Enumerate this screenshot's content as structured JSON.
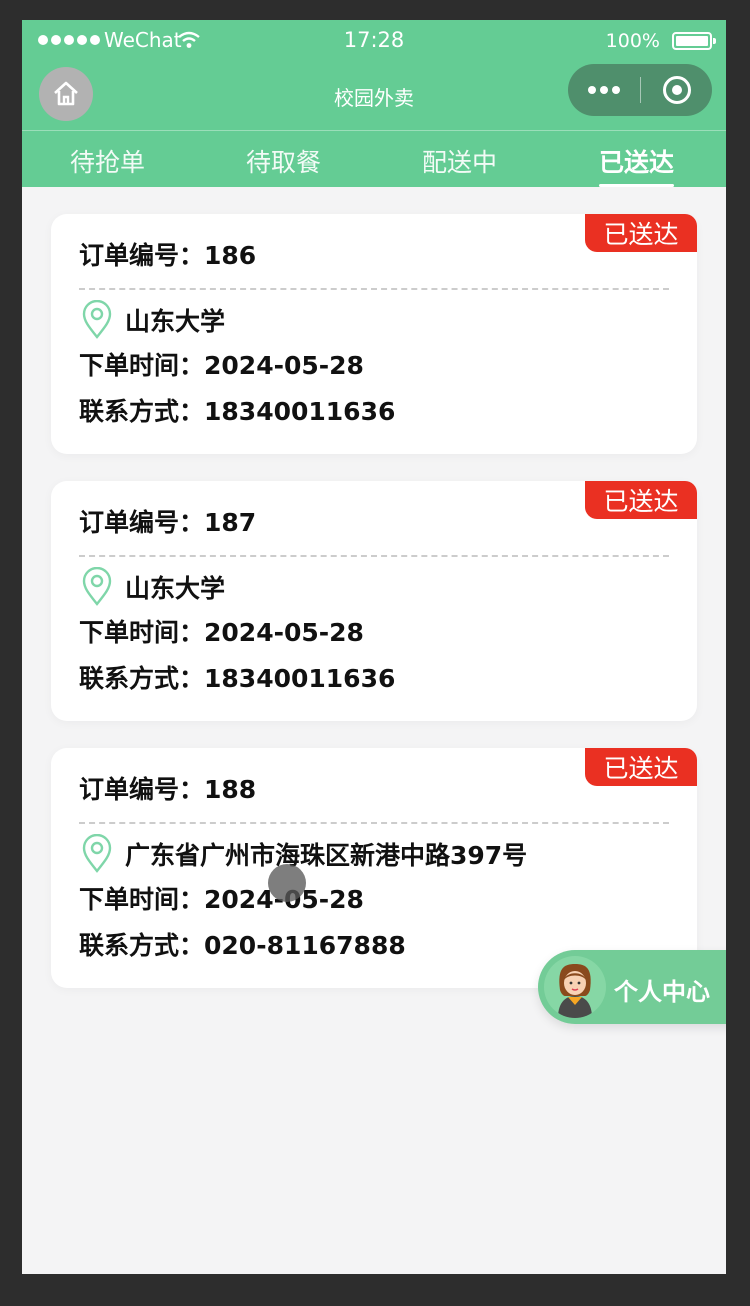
{
  "status_bar": {
    "carrier": "WeChat",
    "time": "17:28",
    "battery": "100%"
  },
  "nav": {
    "title": "校园外卖"
  },
  "tabs": [
    {
      "label": "待抢单",
      "active": false
    },
    {
      "label": "待取餐",
      "active": false
    },
    {
      "label": "配送中",
      "active": false
    },
    {
      "label": "已送达",
      "active": true
    }
  ],
  "labels": {
    "order_no": "订单编号：",
    "order_time": "下单时间：",
    "contact": "联系方式："
  },
  "orders": [
    {
      "status": "已送达",
      "order_no": "186",
      "address": "山东大学",
      "order_time": "2024-05-28",
      "contact": "18340011636"
    },
    {
      "status": "已送达",
      "order_no": "187",
      "address": "山东大学",
      "order_time": "2024-05-28",
      "contact": "18340011636"
    },
    {
      "status": "已送达",
      "order_no": "188",
      "address": "广东省广州市海珠区新港中路397号",
      "order_time": "2024-05-28",
      "contact": "020-81167888"
    }
  ],
  "fab": {
    "label": "个人中心"
  },
  "colors": {
    "primary": "#64cc94",
    "badge": "#ea3022",
    "page_bg": "#f4f4f5",
    "pin": "#7fd6a9"
  }
}
